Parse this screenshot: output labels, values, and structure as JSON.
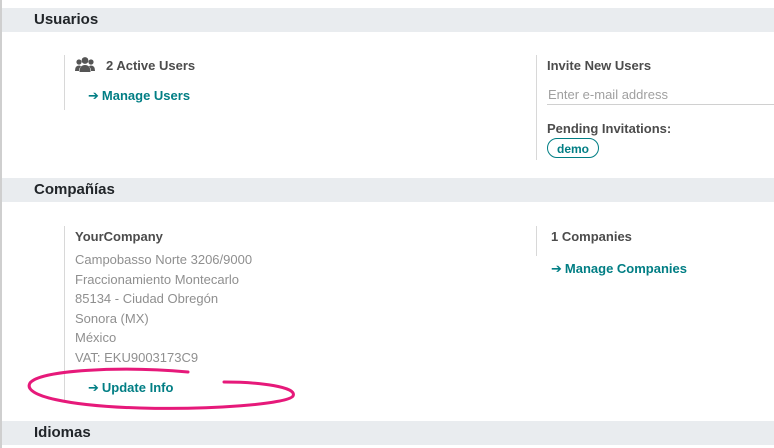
{
  "sections": {
    "users": "Usuarios",
    "companies": "Compañías",
    "languages": "Idiomas"
  },
  "users": {
    "icon": "users-icon",
    "active_users": "2 Active Users",
    "manage_users": "Manage Users",
    "invite_title": "Invite New Users",
    "email_placeholder": "Enter e-mail address",
    "pending_label": "Pending Invitations:",
    "pending_items": [
      "demo"
    ]
  },
  "company": {
    "name": "YourCompany",
    "address": [
      "Campobasso Norte 3206/9000",
      "Fraccionamiento Montecarlo",
      "85134 - Ciudad Obregón",
      "Sonora (MX)",
      "México",
      "VAT: EKU9003173C9"
    ],
    "update_info": "Update Info",
    "count": "1 Companies",
    "manage_companies": "Manage Companies"
  },
  "arrow_glyph": "➔",
  "colors": {
    "link": "#017e84",
    "section_bar": "#e9ecef",
    "annotation": "#e6197a"
  }
}
